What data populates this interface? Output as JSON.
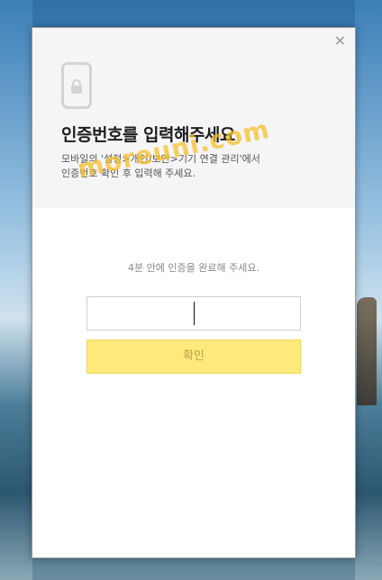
{
  "dialog": {
    "close_label": "×",
    "title": "인증번호를 입력해주세요",
    "description_line1": "모바일의 '설정>개인/보안>기기 연결 관리'에서",
    "description_line2": "인증번호 확인 후 입력해 주세요.",
    "watermark": "moreuni.com",
    "notice": "4분 안에 인증을 완료해 주세요.",
    "code_input": {
      "value": "",
      "placeholder": ""
    },
    "confirm_label": "확인",
    "icons": {
      "phone": "phone-lock-icon",
      "close": "close-icon"
    }
  },
  "colors": {
    "confirm_bg": "#fee97a",
    "confirm_text": "#b9a24a",
    "header_bg": "#f5f5f5"
  }
}
